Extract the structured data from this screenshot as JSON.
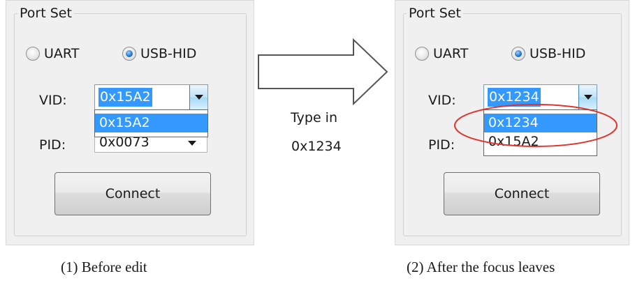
{
  "left": {
    "group_title": "Port Set",
    "radio_uart": "UART",
    "radio_usbhid": "USB-HID",
    "vid_label": "VID:",
    "vid_value": "0x15A2",
    "vid_dropdown": [
      "0x15A2"
    ],
    "pid_label": "PID:",
    "pid_value": "0x0073",
    "connect_label": "Connect",
    "caption": "(1) Before edit"
  },
  "middle": {
    "line1": "Type in",
    "line2": "0x1234"
  },
  "right": {
    "group_title": "Port Set",
    "radio_uart": "UART",
    "radio_usbhid": "USB-HID",
    "vid_label": "VID:",
    "vid_value": "0x1234",
    "vid_dropdown": [
      "0x1234",
      "0x15A2"
    ],
    "pid_label": "PID:",
    "connect_label": "Connect",
    "caption": "(2) After the focus leaves"
  },
  "colors": {
    "selection": "#3399ff",
    "highlight_ellipse": "#e0342c",
    "panel": "#f0f0f0"
  }
}
